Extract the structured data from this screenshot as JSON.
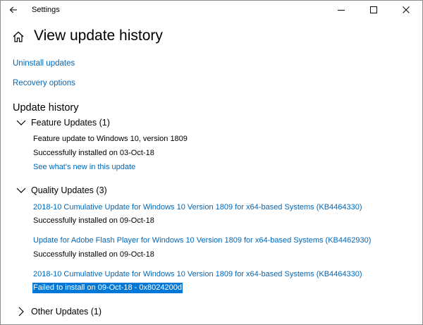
{
  "window": {
    "title": "Settings",
    "accent": "#0067b8",
    "selection_color": "#0078d7"
  },
  "titlebar": {
    "back_icon": "back-arrow-icon",
    "minimize_icon": "minimize-icon",
    "maximize_icon": "maximize-icon",
    "close_icon": "close-icon"
  },
  "header": {
    "icon": "home-icon",
    "title": "View update history"
  },
  "links": {
    "uninstall": "Uninstall updates",
    "recovery": "Recovery options"
  },
  "history": {
    "title": "Update history",
    "groups": [
      {
        "label": "Feature Updates (1)",
        "expanded": true,
        "items": [
          {
            "name": "Feature update to Windows 10, version 1809",
            "status": "Successfully installed on 03-Oct-18",
            "link": "See what's new in this update"
          }
        ]
      },
      {
        "label": "Quality Updates (3)",
        "expanded": true,
        "items": [
          {
            "name": "2018-10 Cumulative Update for Windows 10 Version 1809 for x64-based Systems (KB4464330)",
            "status": "Successfully installed on 09-Oct-18"
          },
          {
            "name": "Update for Adobe Flash Player for Windows 10 Version 1809 for x64-based Systems (KB4462930)",
            "status": "Successfully installed on 09-Oct-18"
          },
          {
            "name": "2018-10 Cumulative Update for Windows 10 Version 1809 for x64-based Systems (KB4464330)",
            "status": "Failed to install on 09-Oct-18 - 0x8024200d",
            "selected": true
          }
        ]
      },
      {
        "label": "Other Updates (1)",
        "expanded": false,
        "items": []
      }
    ]
  }
}
